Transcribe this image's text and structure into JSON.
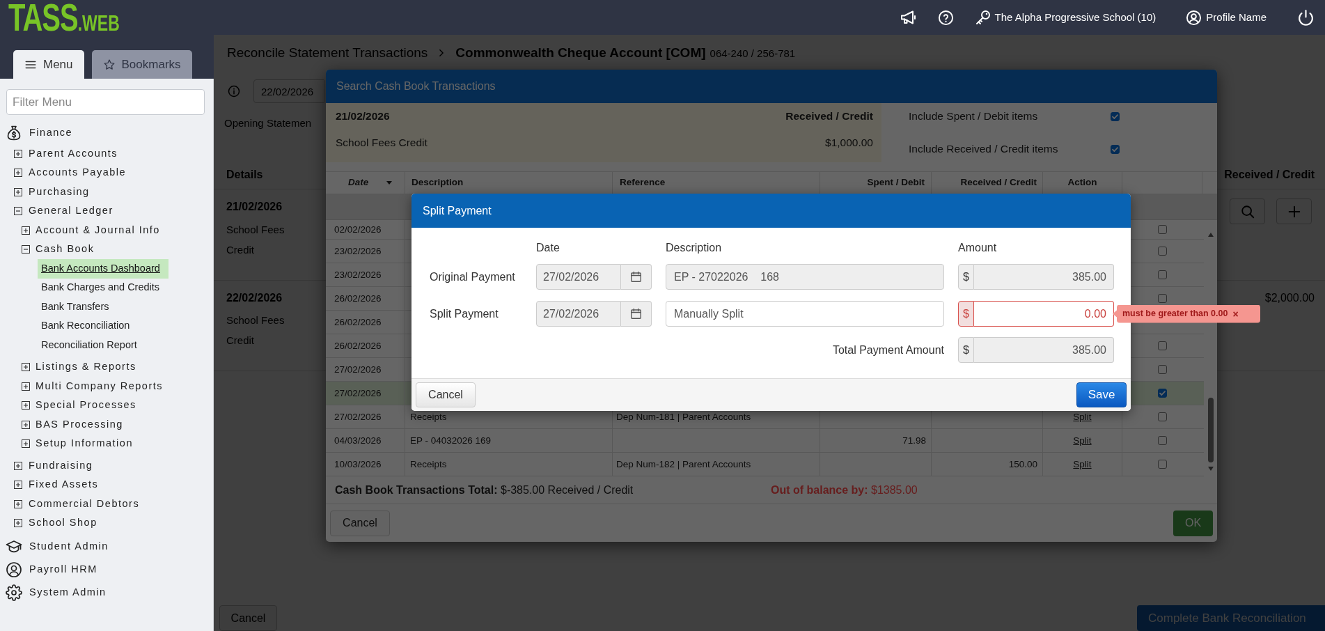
{
  "top_bar": {
    "logo": {
      "text": "TASS",
      "suffix": ".WEB"
    },
    "school": "The Alpha Progressive School (10)",
    "profile": "Profile Name"
  },
  "sidebar": {
    "tabs": [
      {
        "label": "Menu",
        "selected": true
      },
      {
        "label": "Bookmarks",
        "selected": false
      }
    ],
    "filter": {
      "placeholder": "Filter Menu"
    },
    "items": [
      {
        "label": "Finance",
        "children": [
          {
            "label": "Parent Accounts",
            "expanded": false
          },
          {
            "label": "Accounts Payable",
            "expanded": false
          },
          {
            "label": "Purchasing",
            "expanded": false
          },
          {
            "label": "General Ledger",
            "expanded": true,
            "children": [
              {
                "label": "Account & Journal Info",
                "expanded": false
              },
              {
                "label": "Cash Book",
                "expanded": true,
                "children": [
                  {
                    "label": "Bank Accounts Dashboard",
                    "selected": true
                  },
                  {
                    "label": "Bank Charges and Credits",
                    "selected": false
                  },
                  {
                    "label": "Bank Transfers",
                    "selected": false
                  },
                  {
                    "label": "Bank Reconciliation",
                    "selected": false
                  },
                  {
                    "label": "Reconciliation Report",
                    "selected": false
                  }
                ]
              },
              {
                "label": "Listings & Reports",
                "expanded": false
              },
              {
                "label": "Multi Company Reports",
                "expanded": false
              },
              {
                "label": "Special Processes",
                "expanded": false
              },
              {
                "label": "BAS Processing",
                "expanded": false
              },
              {
                "label": "Setup Information",
                "expanded": false
              }
            ]
          },
          {
            "label": "Fundraising",
            "expanded": false
          },
          {
            "label": "Fixed Assets",
            "expanded": false
          },
          {
            "label": "Commercial Debtors",
            "expanded": false
          },
          {
            "label": "School Shop",
            "expanded": false
          }
        ]
      },
      {
        "label": "Student Admin"
      },
      {
        "label": "Payroll HRM"
      },
      {
        "label": "System Admin"
      }
    ]
  },
  "page": {
    "breadcrumb": {
      "parent": "Reconcile Statement Transactions",
      "account": "Commonwealth Cheque Account [COM]",
      "account_number": "064-240 / 256-781"
    },
    "statement_date": "22/02/2026",
    "opening_label": "Opening Statemen",
    "columns": [
      "Details",
      "Received / Credit"
    ],
    "rows": [
      {
        "date": "21/02/2026",
        "details": "School Fees Credit"
      },
      {
        "date": "22/02/2026",
        "details": "School Fees Credit",
        "amount": "$2,000.00"
      }
    ],
    "buttons": {
      "cancel": "Cancel",
      "complete": "Complete Bank Reconciliation"
    }
  },
  "search_dialog": {
    "title": "Search Cash Book Transactions",
    "statement": {
      "date": "21/02/2026",
      "type": "Received / Credit",
      "description": "School Fees Credit",
      "amount": "$1,000.00"
    },
    "filters": [
      {
        "label": "Include Spent / Debit items",
        "checked": true
      },
      {
        "label": "Include Received / Credit items",
        "checked": true
      }
    ],
    "columns": [
      "Date",
      "Description",
      "Reference",
      "Spent / Debit",
      "Received / Credit",
      "Action"
    ],
    "rows": [
      {
        "date": "02/02/2026",
        "checked": false
      },
      {
        "date": "23/02/2026",
        "checked": false
      },
      {
        "date": "23/02/2026",
        "checked": false
      },
      {
        "date": "26/02/2026",
        "checked": false
      },
      {
        "date": "26/02/2026"
      },
      {
        "date": "26/02/2026",
        "checked": false
      },
      {
        "date": "27/02/2026",
        "checked": false
      },
      {
        "date": "27/02/2026",
        "checked": true
      },
      {
        "date": "27/02/2026",
        "description": "Receipts",
        "reference": "Dep Num-181 | Parent Accounts",
        "action": "Split",
        "checked": false
      },
      {
        "date": "04/03/2026",
        "description": "EP - 04032026 169",
        "spent": "71.98",
        "action": "Split",
        "checked": false
      },
      {
        "date": "10/03/2026",
        "description": "Receipts",
        "reference": "Dep Num-182 | Parent Accounts",
        "received": "150.00",
        "action": "Split",
        "checked": false
      }
    ],
    "total": "**Cash Book Transactions Total:** $-385.00 Received / Credit",
    "out_of_balance": "**Out of balance by:** $1385.00",
    "buttons": {
      "cancel": "Cancel",
      "ok": {
        "label": "OK",
        "disabled": true
      }
    }
  },
  "split_dialog": {
    "title": "Split Payment",
    "columns": [
      "Date",
      "Description",
      "Amount"
    ],
    "rows": [
      {
        "label": "Original Payment",
        "date": {
          "value": "27/02/2026",
          "disabled": true
        },
        "description": {
          "value": "EP - 27022026    168",
          "disabled": true
        },
        "amount": {
          "currency": "$",
          "value": "385.00",
          "disabled": true,
          "invalid": false
        }
      },
      {
        "label": "Split Payment",
        "date": {
          "value": "27/02/2026",
          "disabled": true
        },
        "description": {
          "value": "Manually Split",
          "disabled": false
        },
        "amount": {
          "currency": "$",
          "value": "0.00",
          "disabled": false,
          "invalid": true,
          "error": {
            "message": "must be greater than 0.00",
            "close": "×"
          }
        }
      }
    ],
    "total": {
      "label": "Total Payment Amount",
      "currency": "$",
      "value": "385.00",
      "disabled": true
    },
    "buttons": {
      "cancel": "Cancel",
      "save": "Save"
    }
  }
}
